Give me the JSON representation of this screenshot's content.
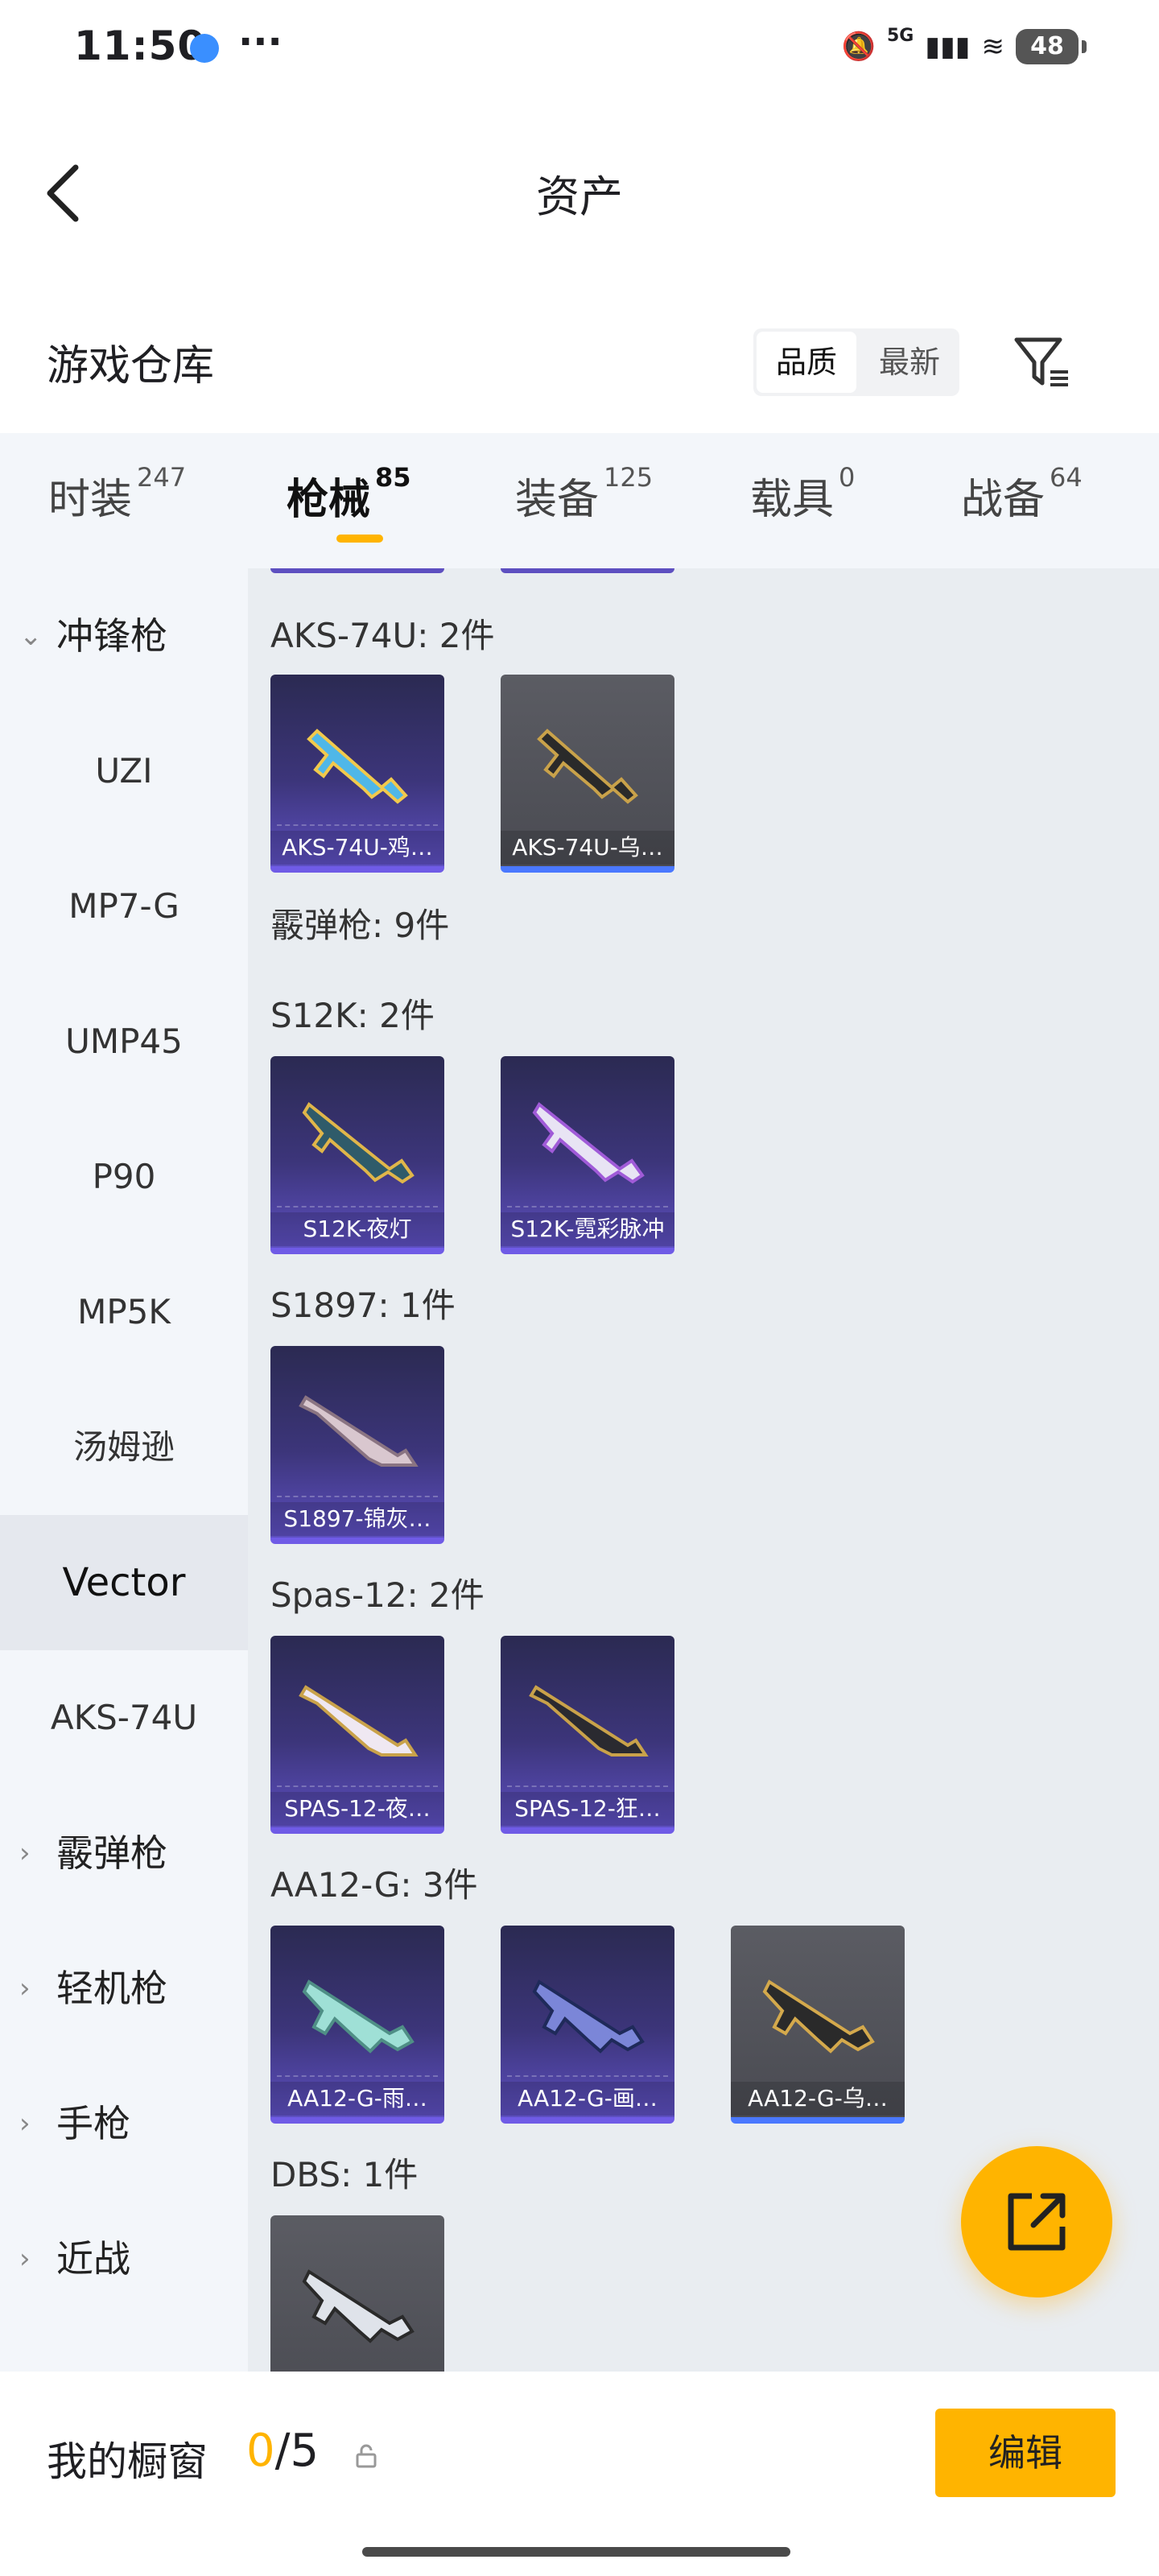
{
  "status": {
    "time": "11:50",
    "network": "5G",
    "battery": "48"
  },
  "header": {
    "title": "资产"
  },
  "warehouse": {
    "title": "游戏仓库",
    "sort_options": [
      "品质",
      "最新"
    ]
  },
  "tabs": [
    {
      "label": "时装",
      "count": "247"
    },
    {
      "label": "枪械",
      "count": "85"
    },
    {
      "label": "装备",
      "count": "125"
    },
    {
      "label": "载具",
      "count": "0"
    },
    {
      "label": "战备",
      "count": "64"
    }
  ],
  "sidebar": [
    {
      "label": "冲锋枪",
      "type": "category",
      "expanded": true
    },
    {
      "label": "UZI"
    },
    {
      "label": "MP7-G"
    },
    {
      "label": "UMP45"
    },
    {
      "label": "P90"
    },
    {
      "label": "MP5K"
    },
    {
      "label": "汤姆逊"
    },
    {
      "label": "Vector",
      "selected": true
    },
    {
      "label": "AKS-74U"
    },
    {
      "label": "霰弹枪",
      "type": "category"
    },
    {
      "label": "轻机枪",
      "type": "category"
    },
    {
      "label": "手枪",
      "type": "category"
    },
    {
      "label": "近战",
      "type": "category"
    }
  ],
  "sections": [
    {
      "title": "AKS-74U: 2件",
      "items": [
        {
          "name": "AKS-74U-鸡…",
          "style": "purple"
        },
        {
          "name": "AKS-74U-乌…",
          "style": "gray"
        }
      ]
    },
    {
      "title": "霰弹枪: 9件",
      "items": []
    },
    {
      "title": "S12K: 2件",
      "items": [
        {
          "name": "S12K-夜灯",
          "style": "purple"
        },
        {
          "name": "S12K-霓彩脉冲",
          "style": "purple"
        }
      ]
    },
    {
      "title": "S1897: 1件",
      "items": [
        {
          "name": "S1897-锦灰…",
          "style": "purple"
        }
      ]
    },
    {
      "title": "Spas-12: 2件",
      "items": [
        {
          "name": "SPAS-12-夜…",
          "style": "purple"
        },
        {
          "name": "SPAS-12-狂…",
          "style": "purple"
        }
      ]
    },
    {
      "title": "AA12-G: 3件",
      "items": [
        {
          "name": "AA12-G-雨…",
          "style": "purple"
        },
        {
          "name": "AA12-G-画…",
          "style": "purple"
        },
        {
          "name": "AA12-G-乌…",
          "style": "gray"
        }
      ]
    },
    {
      "title": "DBS: 1件",
      "items": [
        {
          "name": "",
          "style": "gray"
        }
      ]
    }
  ],
  "bottom": {
    "showcase_label": "我的橱窗",
    "current": "0",
    "total": "/5",
    "edit_label": "编辑"
  },
  "colors": {
    "accent": "#ffb400",
    "card_purple": "#5d4fc0",
    "card_gray": "#4a4b52",
    "blue_bar": "#4a78ff"
  }
}
